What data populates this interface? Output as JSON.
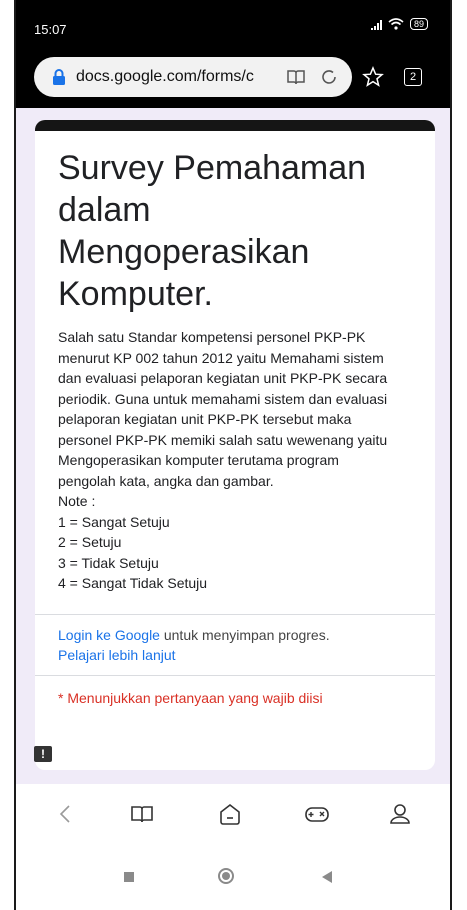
{
  "status_bar": {
    "time": "15:07",
    "battery": "89"
  },
  "browser": {
    "url": "docs.google.com/forms/c",
    "tab_count": "2"
  },
  "form": {
    "title": "Survey Pemahaman dalam Mengoperasikan Komputer.",
    "description": "Salah satu Standar kompetensi personel PKP-PK menurut KP 002 tahun 2012 yaitu Memahami sistem dan evaluasi pelaporan kegiatan unit PKP-PK secara periodik. Guna untuk memahami sistem dan evaluasi pelaporan kegiatan unit PKP-PK tersebut maka personel PKP-PK memiki salah satu wewenang yaitu Mengoperasikan komputer terutama program pengolah kata, angka dan gambar.\nNote :\n1 = Sangat Setuju\n2 = Setuju\n3 = Tidak Setuju\n4 = Sangat Tidak Setuju",
    "login_link": "Login ke Google",
    "login_text": " untuk menyimpan progres.",
    "learn_more": "Pelajari lebih lanjut",
    "required_note": "* Menunjukkan pertanyaan yang wajib diisi",
    "feedback_icon": "!"
  },
  "colors": {
    "accent": "#1a73e8",
    "required": "#d93025",
    "form_bg": "#f0ebf8",
    "header_bar": "#151515"
  },
  "icons": {
    "lock": "lock-icon",
    "reader": "reader-mode-icon",
    "reload": "reload-icon",
    "star": "star-icon",
    "nav_back": "chevron-left-icon",
    "nav_bookmarks": "book-icon",
    "nav_home": "home-icon",
    "nav_games": "gamepad-icon",
    "nav_profile": "profile-icon"
  }
}
